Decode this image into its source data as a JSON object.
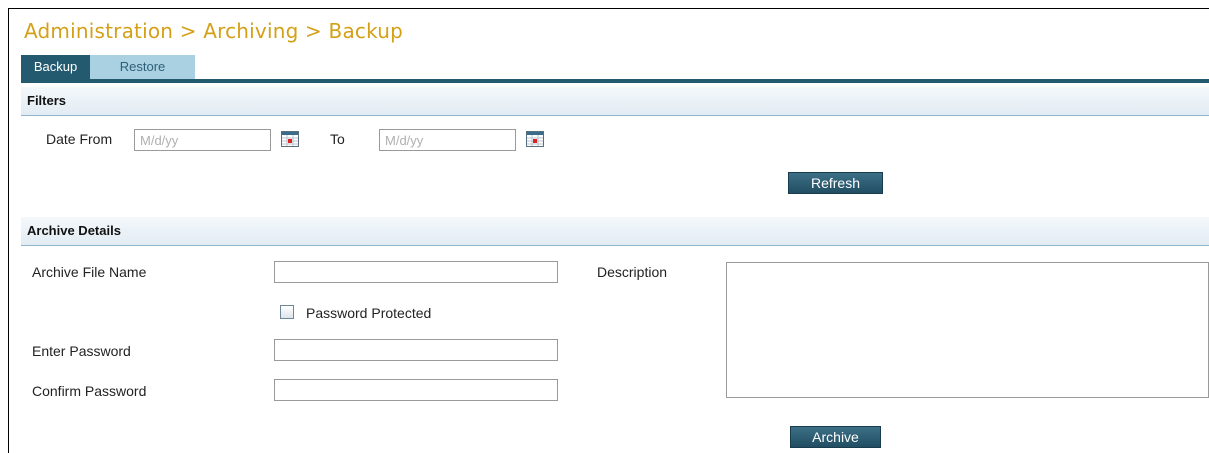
{
  "page": {
    "title": "Administration > Archiving > Backup"
  },
  "tabs": [
    {
      "label": "Backup",
      "active": true
    },
    {
      "label": "Restore",
      "active": false
    }
  ],
  "filters": {
    "header": "Filters",
    "date_from_label": "Date From",
    "date_from_placeholder": "M/d/yy",
    "to_label": "To",
    "to_placeholder": "M/d/yy",
    "calendar_icon": "calendar-icon",
    "refresh_label": "Refresh"
  },
  "archive": {
    "header": "Archive Details",
    "file_name_label": "Archive File Name",
    "file_name_value": "",
    "password_protected_label": "Password Protected",
    "password_protected_checked": false,
    "enter_password_label": "Enter Password",
    "confirm_password_label": "Confirm Password",
    "description_label": "Description",
    "description_value": "",
    "archive_button_label": "Archive"
  },
  "colors": {
    "title": "#d4a017",
    "tab_active": "#235a6f",
    "tab_inactive": "#a9d1e2",
    "button": "#2f5f75"
  }
}
